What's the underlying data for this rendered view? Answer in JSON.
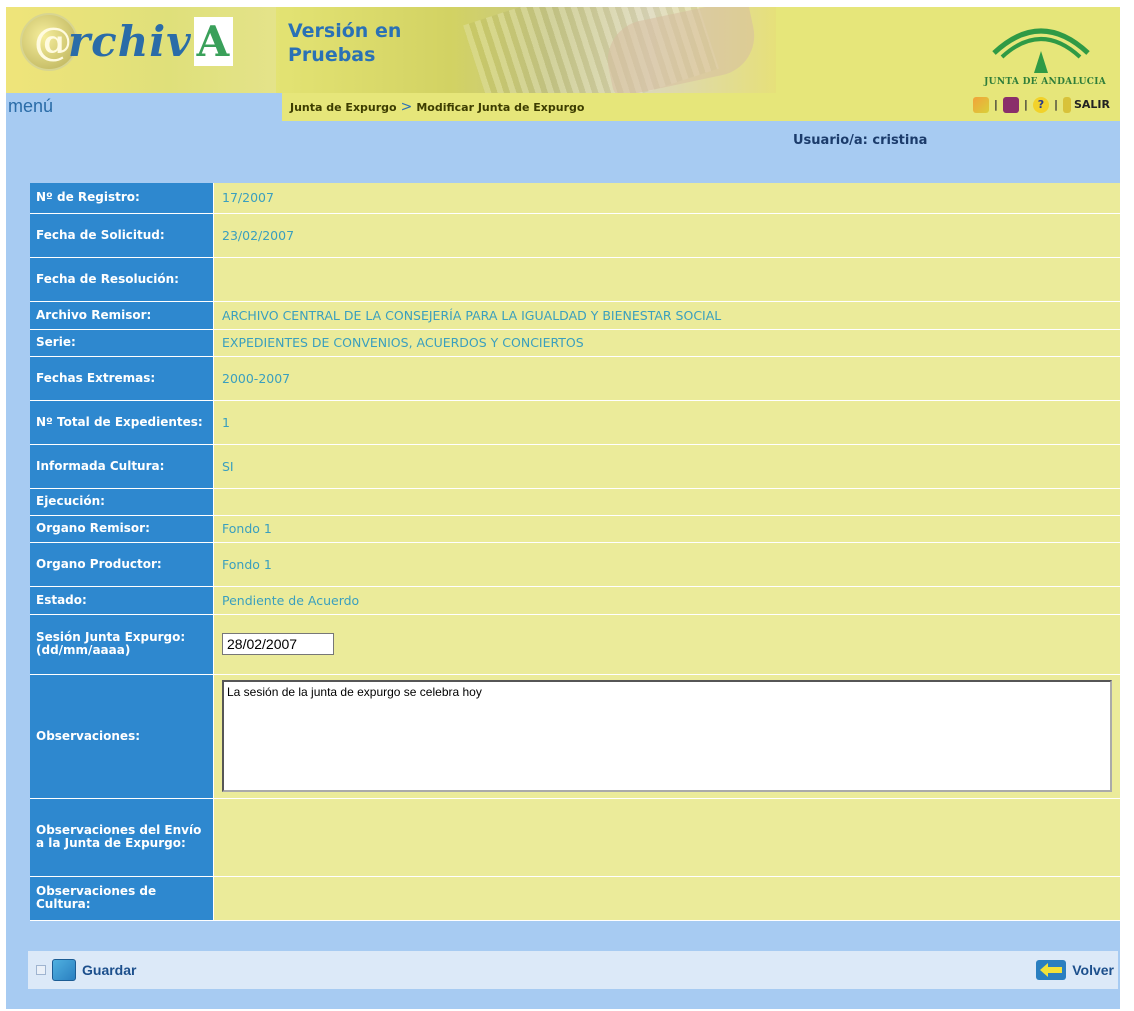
{
  "header": {
    "logo_prefix": "@",
    "logo_word": "rchiv",
    "logo_cap": "A",
    "version_line1": "Versión en",
    "version_line2": "Pruebas",
    "junta_label": "JUNTA DE ANDALUCIA"
  },
  "nav": {
    "menu": "menú",
    "breadcrumb": [
      "Junta de Expurgo",
      "Modificar Junta de Expurgo"
    ],
    "breadcrumb_sep": ">",
    "salir": "SALIR"
  },
  "user": "Usuario/a:  cristina",
  "rows": [
    {
      "label": "Nº de Registro:",
      "value": "17/2007"
    },
    {
      "label": "Fecha de Solicitud:",
      "value": "23/02/2007"
    },
    {
      "label": "Fecha de Resolución:",
      "value": ""
    },
    {
      "label": "Archivo Remisor:",
      "value": "ARCHIVO CENTRAL DE LA CONSEJERÍA PARA LA IGUALDAD Y BIENESTAR SOCIAL"
    },
    {
      "label": "Serie:",
      "value": "EXPEDIENTES DE CONVENIOS, ACUERDOS Y CONCIERTOS"
    },
    {
      "label": "Fechas Extremas:",
      "value": "2000-2007"
    },
    {
      "label": "Nº Total de Expedientes:",
      "value": "1"
    },
    {
      "label": "Informada Cultura:",
      "value": "SI"
    },
    {
      "label": "Ejecución:",
      "value": ""
    },
    {
      "label": "Organo Remisor:",
      "value": "Fondo 1"
    },
    {
      "label": "Organo Productor:",
      "value": "Fondo 1"
    },
    {
      "label": "Estado:",
      "value": "Pendiente de Acuerdo"
    }
  ],
  "sesion": {
    "label": "Sesión Junta Expurgo: (dd/mm/aaaa)",
    "value": "28/02/2007"
  },
  "observaciones": {
    "label": "Observaciones:",
    "value": "La sesión de la junta de expurgo se celebra hoy"
  },
  "obs_envio": {
    "label": "Observaciones del Envío a la Junta de Expurgo:",
    "value": ""
  },
  "obs_cultura": {
    "label": "Observaciones de Cultura:",
    "value": ""
  },
  "footer": {
    "guardar": "Guardar",
    "volver": "Volver"
  },
  "colors": {
    "label_bg": "#2e88cf",
    "value_bg": "#ebeb9a",
    "value_text": "#3a9fbe",
    "page_bg": "#a7cbf2"
  }
}
